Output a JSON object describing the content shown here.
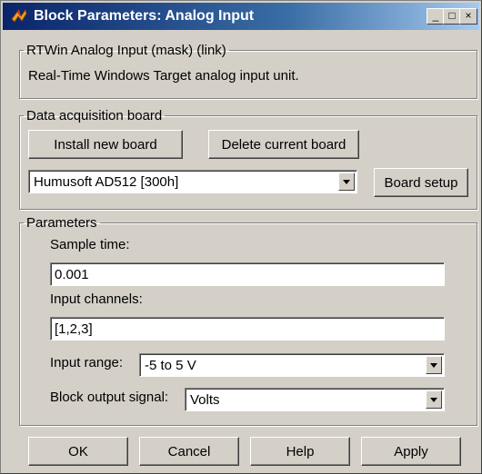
{
  "window": {
    "title": "Block Parameters: Analog Input",
    "minimize_glyph": "_",
    "maximize_glyph": "□",
    "close_glyph": "×"
  },
  "mask": {
    "legend": "RTWin Analog Input (mask) (link)",
    "description": "Real-Time Windows Target analog input unit."
  },
  "board": {
    "legend": "Data acquisition board",
    "install_label": "Install new board",
    "delete_label": "Delete current board",
    "selected_board": "Humusoft AD512 [300h]",
    "setup_label": "Board setup"
  },
  "params": {
    "legend": "Parameters",
    "sample_time_label": "Sample time:",
    "sample_time_value": "0.001",
    "input_channels_label": "Input channels:",
    "input_channels_value": "[1,2,3]",
    "input_range_label": "Input range:",
    "input_range_value": "-5 to 5 V",
    "output_signal_label": "Block output signal:",
    "output_signal_value": "Volts"
  },
  "footer": {
    "ok_label": "OK",
    "cancel_label": "Cancel",
    "help_label": "Help",
    "apply_label": "Apply"
  }
}
